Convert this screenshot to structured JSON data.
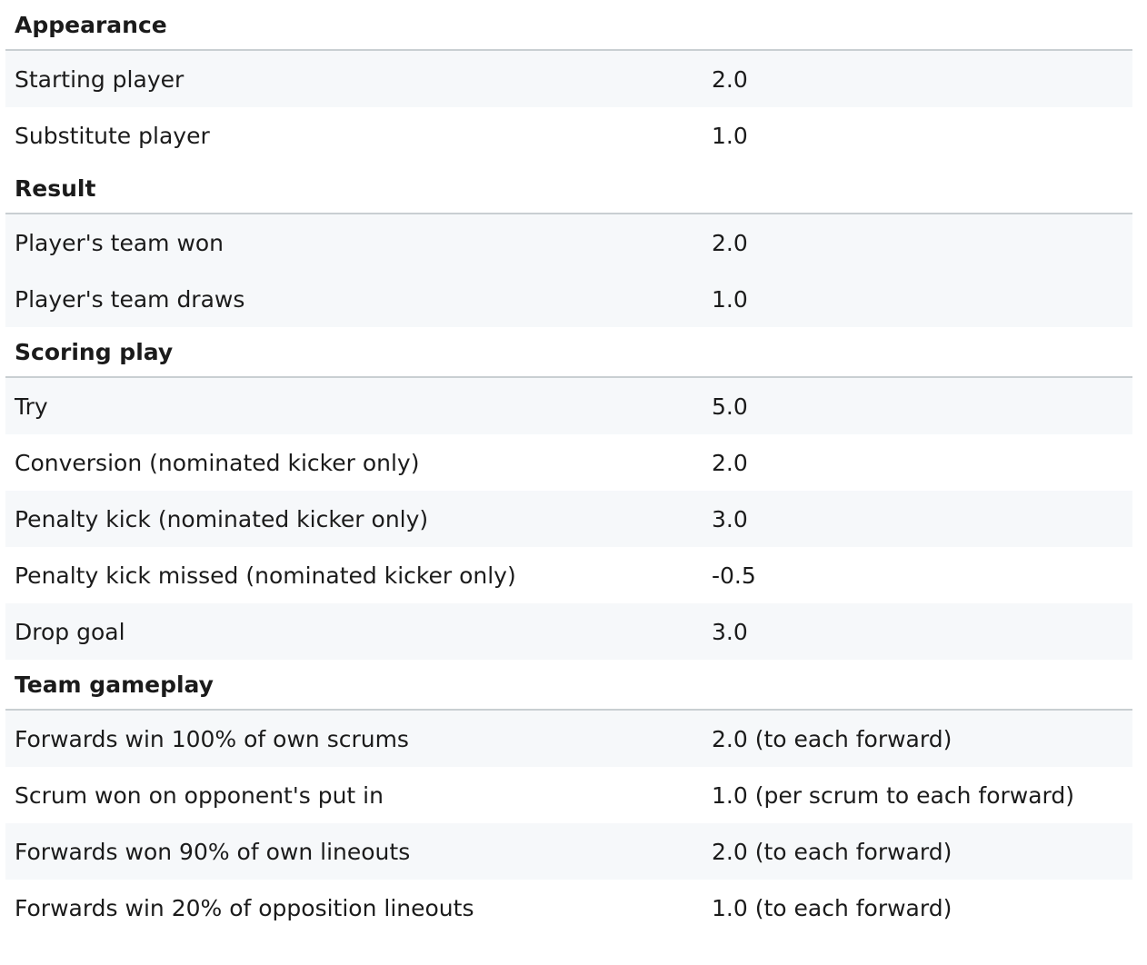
{
  "sections": [
    {
      "title": "Appearance",
      "rows": [
        {
          "label": "Starting player",
          "points": "2.0"
        },
        {
          "label": "Substitute player",
          "points": "1.0"
        }
      ]
    },
    {
      "title": "Result",
      "rows": [
        {
          "label": "Player's team won",
          "points": "2.0"
        },
        {
          "label": "Player's team draws",
          "points": "1.0"
        }
      ]
    },
    {
      "title": "Scoring play",
      "rows": [
        {
          "label": "Try",
          "points": "5.0"
        },
        {
          "label": "Conversion (nominated kicker only)",
          "points": "2.0"
        },
        {
          "label": "Penalty kick (nominated kicker only)",
          "points": "3.0"
        },
        {
          "label": "Penalty kick missed (nominated kicker only)",
          "points": "-0.5"
        },
        {
          "label": "Drop goal",
          "points": "3.0"
        }
      ]
    },
    {
      "title": "Team gameplay",
      "rows": [
        {
          "label": "Forwards win 100% of own scrums",
          "points": "2.0 (to each forward)"
        },
        {
          "label": "Scrum won on opponent's put in",
          "points": "1.0 (per scrum to each forward)"
        },
        {
          "label": "Forwards won 90% of own lineouts",
          "points": "2.0 (to each forward)"
        },
        {
          "label": "Forwards win 20% of opposition lineouts",
          "points": "1.0 (to each forward)"
        }
      ]
    }
  ]
}
